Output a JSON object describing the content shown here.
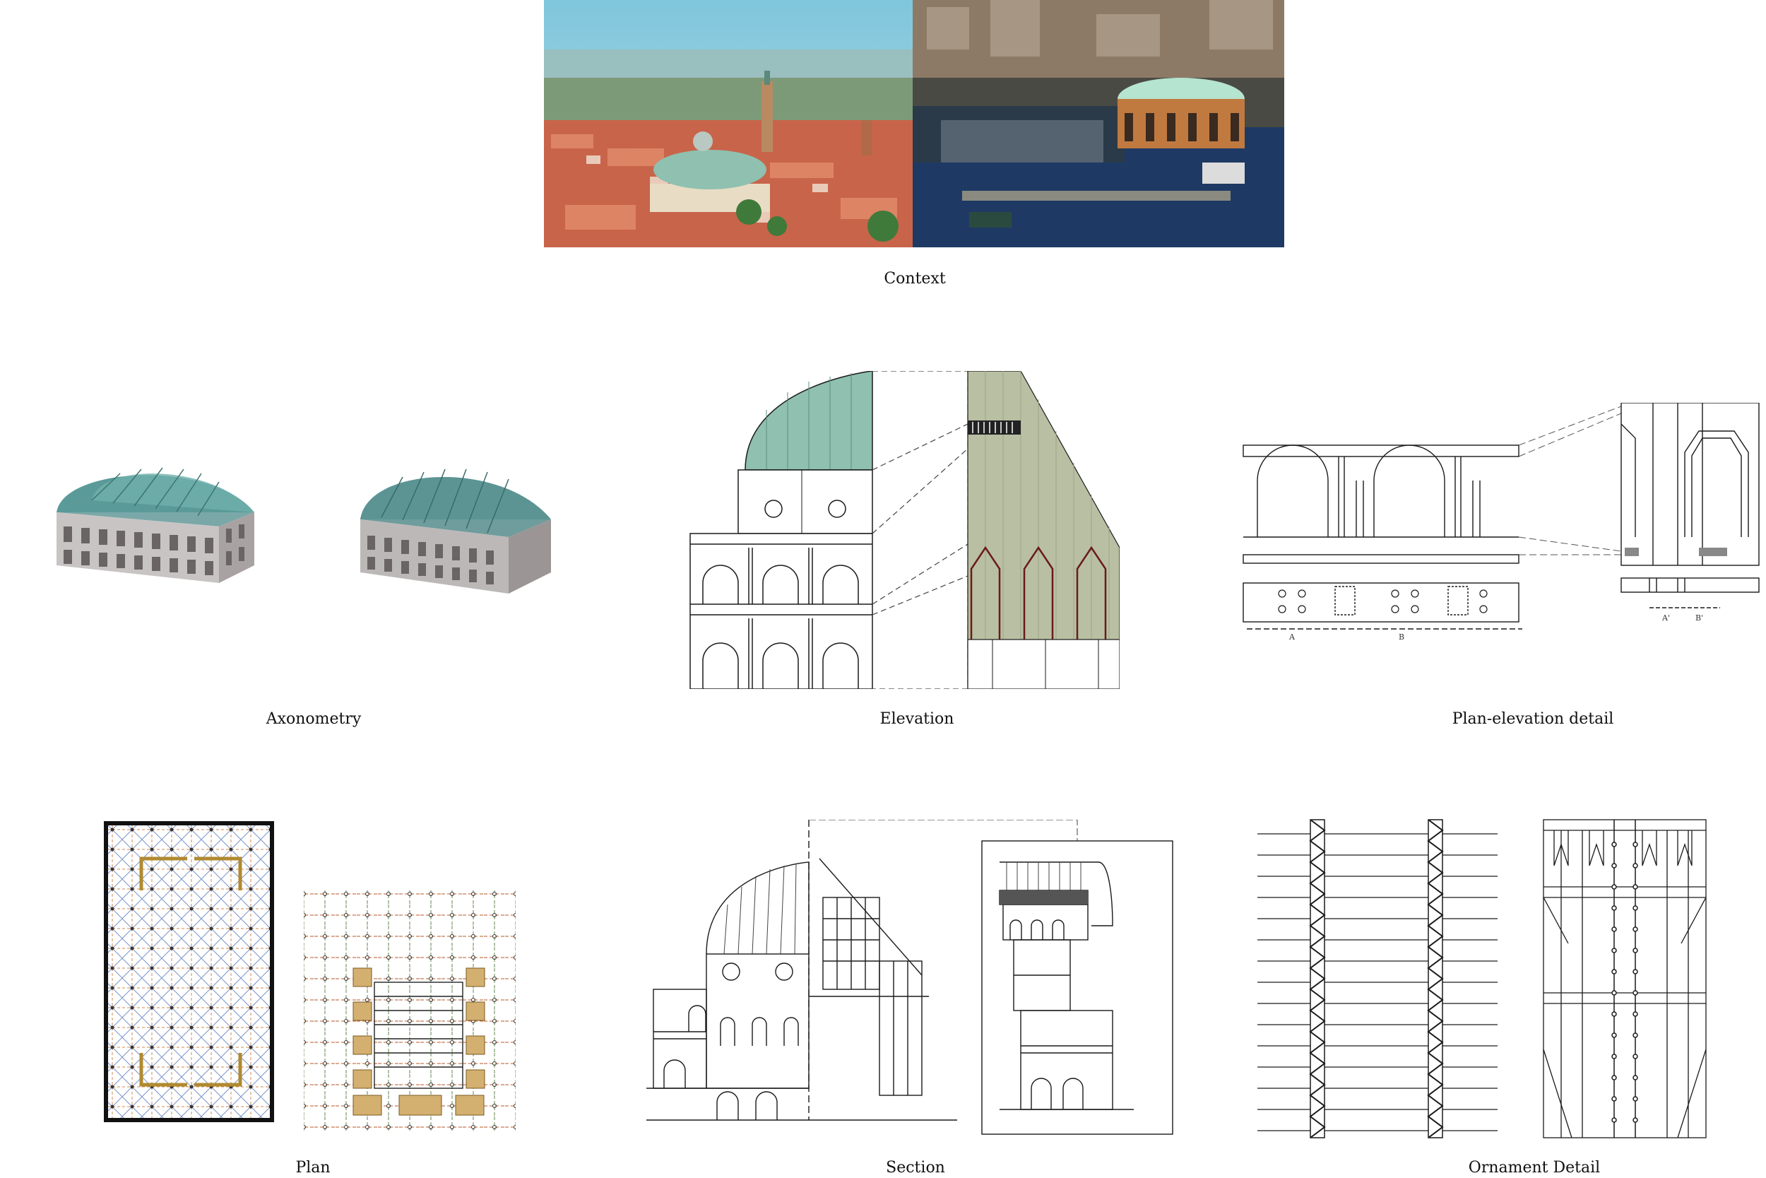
{
  "captions": {
    "context": "Context",
    "axonometry": "Axonometry",
    "elevation": "Elevation",
    "plan_elevation_detail": "Plan-elevation detail",
    "plan": "Plan",
    "section": "Section",
    "ornament_detail": "Ornament Detail"
  },
  "detail_labels": {
    "a": "A",
    "b": "B",
    "a_prime": "A'",
    "b_prime": "B'"
  },
  "colors": {
    "dome_green": "#8fc0b0",
    "dome_teal": "#5a9a98",
    "roof_tile": "#c8644a",
    "sage_panel": "#b9bfa3",
    "ochre_plan": "#d4b070",
    "line": "#1a1a1a"
  }
}
